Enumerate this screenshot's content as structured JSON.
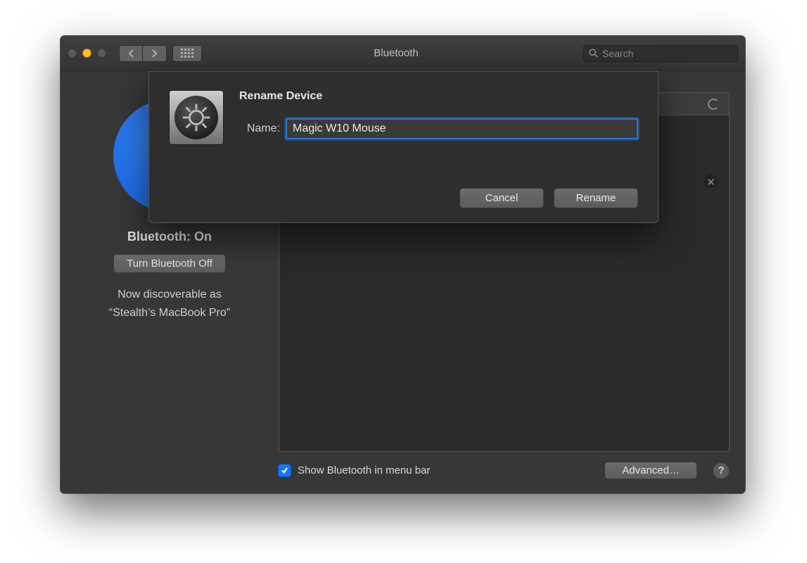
{
  "window": {
    "title": "Bluetooth",
    "search_placeholder": "Search"
  },
  "sidebar": {
    "status_label": "Bluetooth: On",
    "toggle_label": "Turn Bluetooth Off",
    "discover_line1": "Now discoverable as",
    "discover_line2": "“Stealth’s MacBook Pro”"
  },
  "main": {
    "menubar_label": "Show Bluetooth in menu bar",
    "menubar_checked": true,
    "advanced_label": "Advanced…",
    "help_label": "?"
  },
  "sheet": {
    "title": "Rename Device",
    "field_label": "Name:",
    "field_value": "Magic W10 Mouse",
    "cancel_label": "Cancel",
    "confirm_label": "Rename"
  }
}
